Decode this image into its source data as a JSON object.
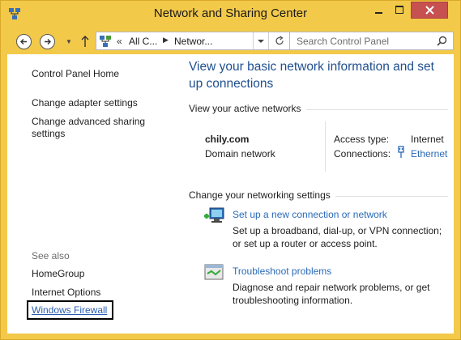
{
  "window": {
    "title": "Network and Sharing Center",
    "icon": "network-center-icon"
  },
  "toolbar": {
    "address_crumbs": [
      "All C...",
      "Networ..."
    ],
    "address_prefix": "«",
    "search_placeholder": "Search Control Panel"
  },
  "sidebar": {
    "items": [
      {
        "label": "Control Panel Home"
      },
      {
        "label": "Change adapter settings"
      },
      {
        "label": "Change advanced sharing settings"
      }
    ],
    "see_also_label": "See also",
    "see_also_items": [
      {
        "label": "HomeGroup"
      },
      {
        "label": "Internet Options"
      },
      {
        "label": "Windows Firewall"
      }
    ]
  },
  "main": {
    "heading": "View your basic network information and set up connections",
    "active_networks_label": "View your active networks",
    "network": {
      "name": "chily.com",
      "type": "Domain network",
      "access_type_label": "Access type:",
      "access_type_value": "Internet",
      "connections_label": "Connections:",
      "connections_value": "Ethernet"
    },
    "change_settings_label": "Change your networking settings",
    "tasks": [
      {
        "link": "Set up a new connection or network",
        "description": "Set up a broadband, dial-up, or VPN connection; or set up a router or access point.",
        "icon": "new-connection-icon"
      },
      {
        "link": "Troubleshoot problems",
        "description": "Diagnose and repair network problems, or get troubleshooting information.",
        "icon": "troubleshoot-icon"
      }
    ]
  },
  "colors": {
    "frame": "#f3c94a",
    "close": "#c75050",
    "heading": "#1f4f8f",
    "link": "#2a6ab8"
  }
}
